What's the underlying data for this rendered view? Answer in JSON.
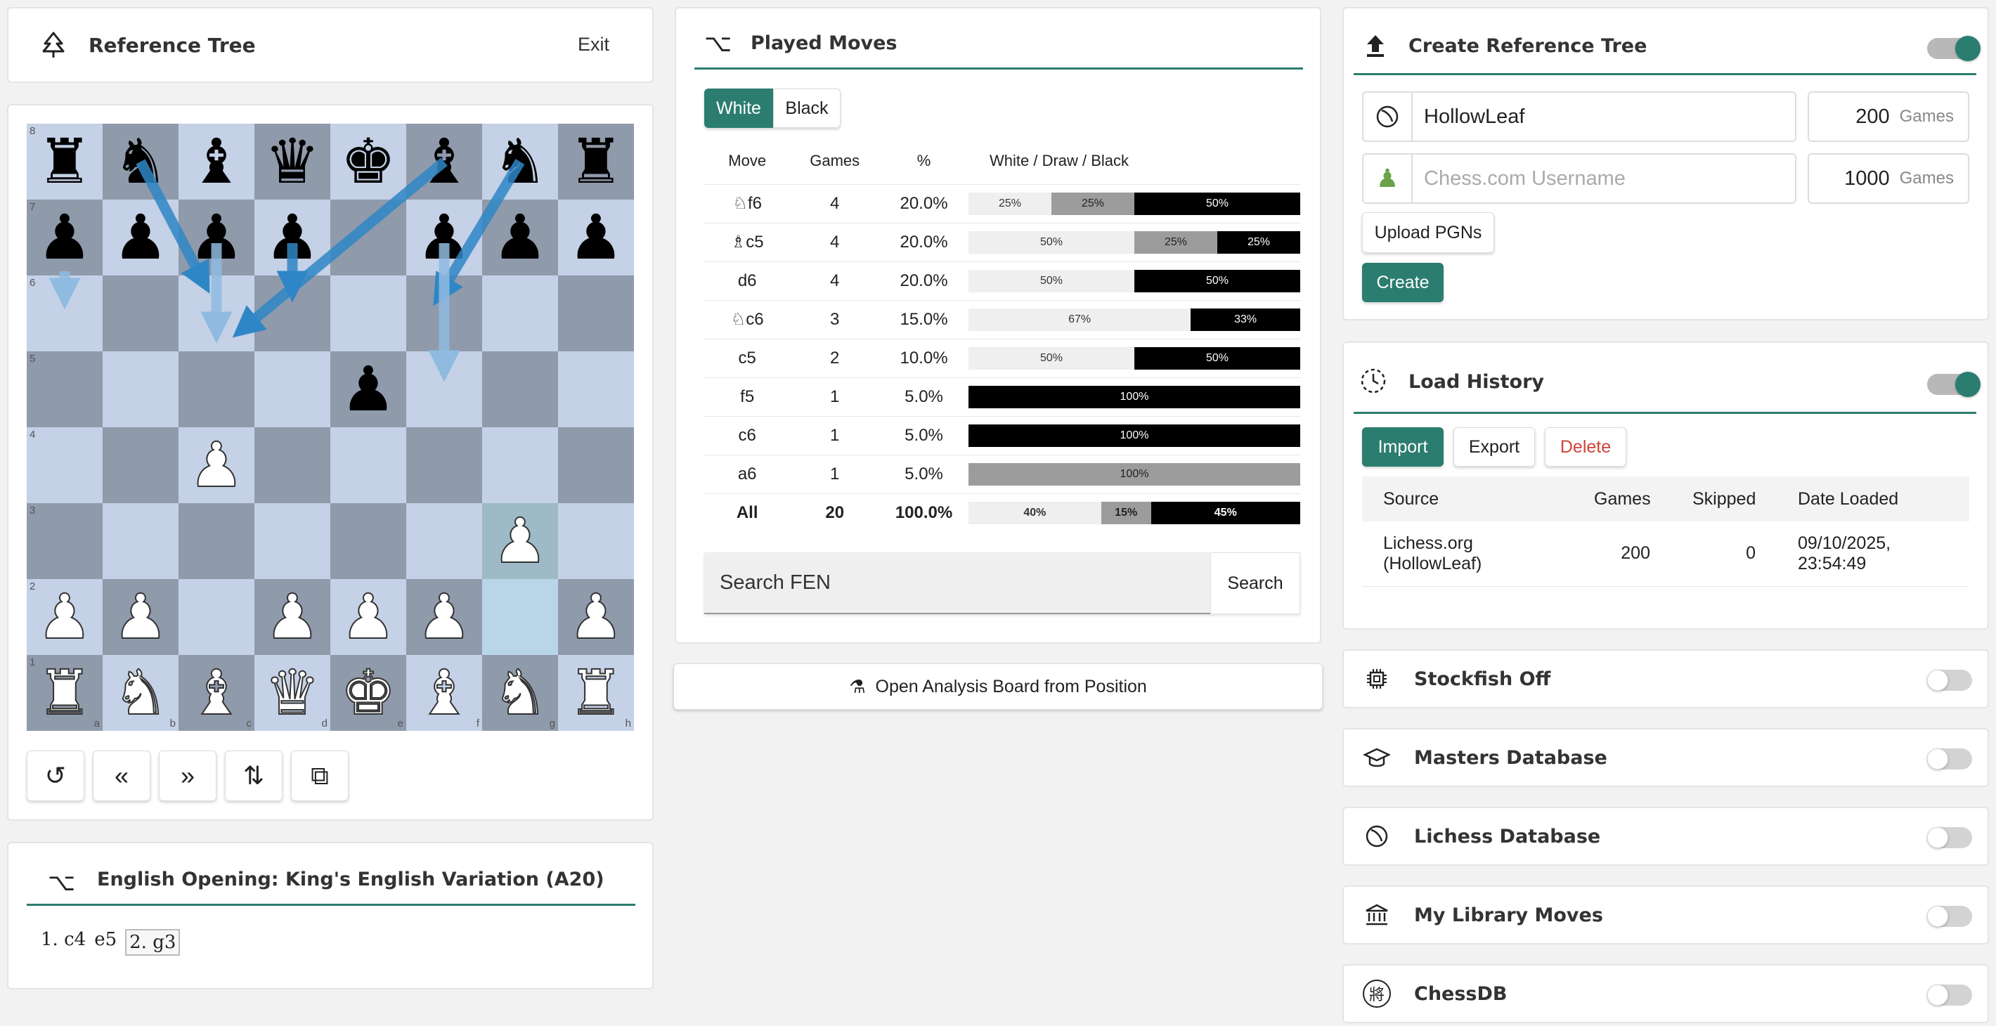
{
  "ref_tree": {
    "title": "Reference Tree",
    "exit": "Exit"
  },
  "board": {
    "ranks": [
      "8",
      "7",
      "6",
      "5",
      "4",
      "3",
      "2",
      "1"
    ],
    "files": [
      "a",
      "b",
      "c",
      "d",
      "e",
      "f",
      "g",
      "h"
    ],
    "rows": [
      [
        "br",
        "bn",
        "bb",
        "bq",
        "bk",
        "bb",
        "bn",
        "br"
      ],
      [
        "bp",
        "bp",
        "bp",
        "bp",
        "",
        "bp",
        "bp",
        "bp"
      ],
      [
        "",
        "",
        "",
        "",
        "",
        "",
        "",
        ""
      ],
      [
        "",
        "",
        "",
        "",
        "bp",
        "",
        "",
        ""
      ],
      [
        "",
        "",
        "wp",
        "",
        "",
        "",
        "",
        ""
      ],
      [
        "",
        "",
        "",
        "",
        "",
        "",
        "wp",
        ""
      ],
      [
        "wp",
        "wp",
        "",
        "wp",
        "wp",
        "wp",
        "",
        "wp"
      ],
      [
        "wr",
        "wn",
        "wb",
        "wq",
        "wk",
        "wb",
        "wn",
        "wr"
      ]
    ],
    "last_move_squares": [
      "g2",
      "g3"
    ]
  },
  "controls": [
    {
      "icon": "undo-icon",
      "glyph": "↺"
    },
    {
      "icon": "double-left-icon",
      "glyph": "«"
    },
    {
      "icon": "double-right-icon",
      "glyph": "»"
    },
    {
      "icon": "flip-board-icon",
      "glyph": "⇅"
    },
    {
      "icon": "copy-pgn-icon",
      "glyph": "⧉"
    }
  ],
  "opening": {
    "title": "English Opening: King's English Variation (A20)",
    "moves": [
      "1. c4",
      "e5",
      "2. g3"
    ],
    "selected": "2. g3"
  },
  "played": {
    "title": "Played Moves",
    "tabs": [
      "White",
      "Black"
    ],
    "active_tab": "White",
    "headers": [
      "Move",
      "Games",
      "%",
      "White / Draw / Black"
    ],
    "rows": [
      {
        "move": "♘f6",
        "games": "4",
        "pct": "20.0%",
        "w": 25,
        "d": 25,
        "b": 50,
        "wl": "25%",
        "dl": "25%",
        "bl": "50%"
      },
      {
        "move": "♗c5",
        "games": "4",
        "pct": "20.0%",
        "w": 50,
        "d": 25,
        "b": 25,
        "wl": "50%",
        "dl": "25%",
        "bl": "25%"
      },
      {
        "move": "d6",
        "games": "4",
        "pct": "20.0%",
        "w": 50,
        "d": 0,
        "b": 50,
        "wl": "50%",
        "dl": "",
        "bl": "50%"
      },
      {
        "move": "♘c6",
        "games": "3",
        "pct": "15.0%",
        "w": 67,
        "d": 0,
        "b": 33,
        "wl": "67%",
        "dl": "",
        "bl": "33%"
      },
      {
        "move": "c5",
        "games": "2",
        "pct": "10.0%",
        "w": 50,
        "d": 0,
        "b": 50,
        "wl": "50%",
        "dl": "",
        "bl": "50%"
      },
      {
        "move": "f5",
        "games": "1",
        "pct": "5.0%",
        "w": 0,
        "d": 0,
        "b": 100,
        "wl": "",
        "dl": "",
        "bl": "100%"
      },
      {
        "move": "c6",
        "games": "1",
        "pct": "5.0%",
        "w": 0,
        "d": 0,
        "b": 100,
        "wl": "",
        "dl": "",
        "bl": "100%"
      },
      {
        "move": "a6",
        "games": "1",
        "pct": "5.0%",
        "w": 0,
        "d": 100,
        "b": 0,
        "wl": "",
        "dl": "100%",
        "bl": ""
      }
    ],
    "total": {
      "move": "All",
      "games": "20",
      "pct": "100.0%",
      "w": 40,
      "d": 15,
      "b": 45,
      "wl": "40%",
      "dl": "15%",
      "bl": "45%"
    },
    "search_placeholder": "Search FEN",
    "search_button": "Search"
  },
  "analysis_button": "Open Analysis Board from Position",
  "create": {
    "title": "Create Reference Tree",
    "lichess_user": "HollowLeaf",
    "lichess_games": "200",
    "chesscom_placeholder": "Chess.com Username",
    "chesscom_games": "1000",
    "games_label": "Games",
    "upload": "Upload PGNs",
    "create": "Create",
    "enabled": true
  },
  "history": {
    "title": "Load History",
    "import": "Import",
    "export": "Export",
    "delete": "Delete",
    "headers": [
      "Source",
      "Games",
      "Skipped",
      "Date Loaded"
    ],
    "rows": [
      {
        "source1": "Lichess.org",
        "source2": "(HollowLeaf)",
        "games": "200",
        "skipped": "0",
        "date1": "09/10/2025,",
        "date2": "23:54:49"
      }
    ],
    "enabled": true
  },
  "engines": [
    {
      "name": "Stockfish Off",
      "icon": "cpu-icon"
    },
    {
      "name": "Masters Database",
      "icon": "graduation-cap-icon"
    },
    {
      "name": "Lichess Database",
      "icon": "lichess-icon"
    },
    {
      "name": "My Library Moves",
      "icon": "library-icon"
    },
    {
      "name": "ChessDB",
      "icon": "chessdb-icon",
      "glyph": "將"
    }
  ],
  "colors": {
    "accent": "#2b7d6f",
    "arrow": "#2f86c6"
  }
}
